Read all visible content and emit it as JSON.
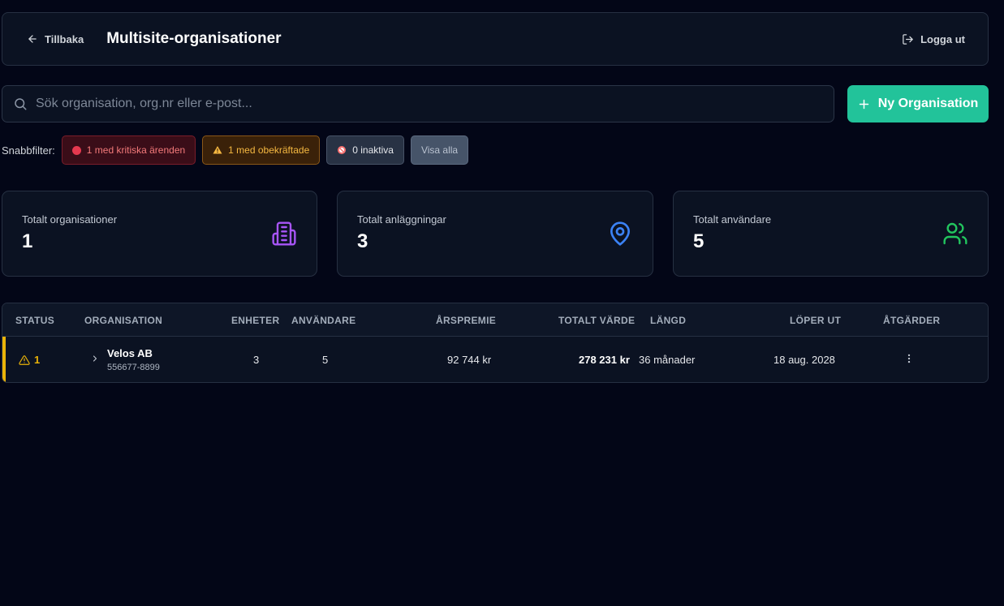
{
  "header": {
    "back_label": "Tillbaka",
    "title": "Multisite-organisationer",
    "logout_label": "Logga ut"
  },
  "search": {
    "placeholder": "Sök organisation, org.nr eller e-post...",
    "value": ""
  },
  "new_org_label": "Ny Organisation",
  "filters": {
    "label": "Snabbfilter:",
    "critical": "1 med kritiska ärenden",
    "unconfirmed": "1 med obekräftade",
    "inactive": "0 inaktiva",
    "all": "Visa alla"
  },
  "stats": [
    {
      "title": "Totalt organisationer",
      "value": "1",
      "icon": "building-icon",
      "color": "#a855f7"
    },
    {
      "title": "Totalt anläggningar",
      "value": "3",
      "icon": "map-pin-icon",
      "color": "#3b82f6"
    },
    {
      "title": "Totalt användare",
      "value": "5",
      "icon": "users-icon",
      "color": "#22c55e"
    }
  ],
  "table": {
    "headers": {
      "status": "STATUS",
      "organisation": "ORGANISATION",
      "enheter": "ENHETER",
      "anvandare": "ANVÄNDARE",
      "arspremie": "ÅRSPREMIE",
      "totalt_varde": "TOTALT VÄRDE",
      "langd": "LÄNGD",
      "loper_ut": "LÖPER UT",
      "atgarder": "ÅTGÄRDER"
    },
    "rows": [
      {
        "status_count": "1",
        "name": "Velos AB",
        "org_nr": "556677-8899",
        "enheter": "3",
        "anvandare": "5",
        "arspremie": "92 744 kr",
        "totalt_varde": "278 231 kr",
        "langd": "36 månader",
        "loper_ut": "18 aug. 2028"
      }
    ]
  },
  "colors": {
    "accent": "#22c39a",
    "warning": "#eab308",
    "critical": "#e5394f"
  }
}
